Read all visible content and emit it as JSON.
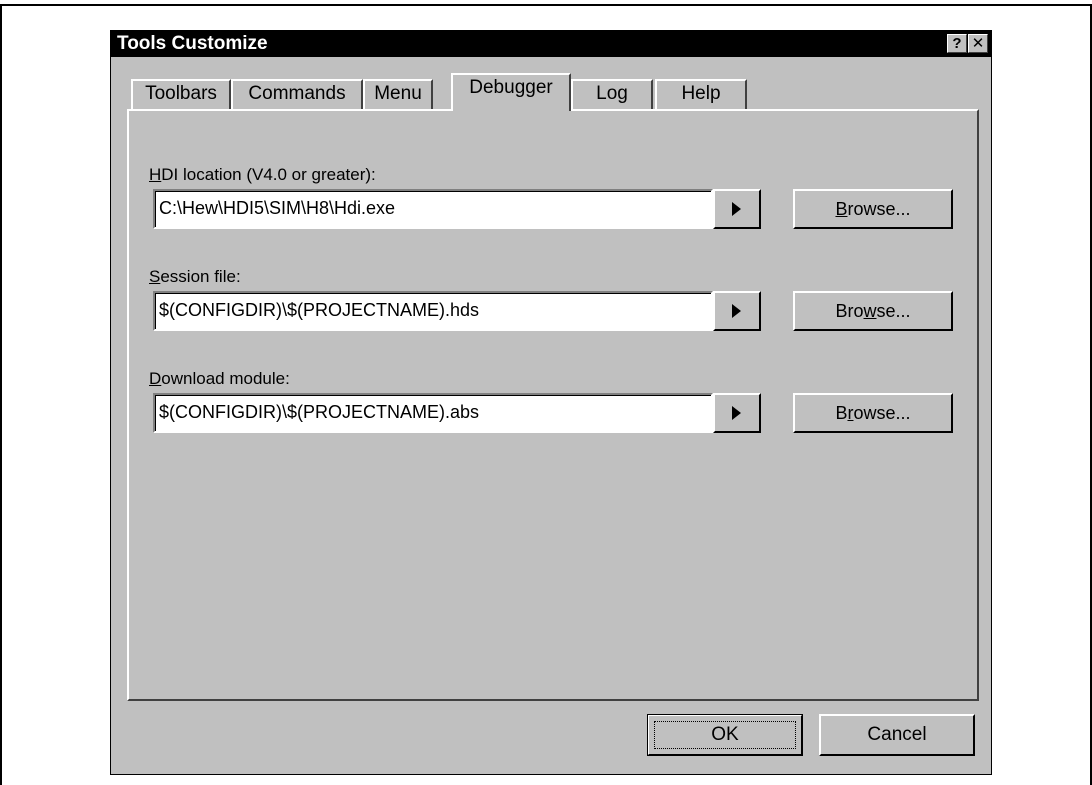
{
  "dialog": {
    "title": "Tools Customize",
    "help_glyph": "?",
    "close_glyph": "✕"
  },
  "tabs": [
    {
      "label": "Toolbars",
      "active": false
    },
    {
      "label": "Commands",
      "active": false
    },
    {
      "label": "Menu",
      "active": false
    },
    {
      "label": "Debugger",
      "active": true
    },
    {
      "label": "Log",
      "active": false
    },
    {
      "label": "Help",
      "active": false
    }
  ],
  "fields": {
    "hdi": {
      "label_mnemonic": "H",
      "label_rest": "DI location (V4.0 or greater):",
      "value": "C:\\Hew\\HDI5\\SIM\\H8\\Hdi.exe",
      "browse_pre": "",
      "browse_mnemonic": "B",
      "browse_post": "rowse..."
    },
    "session": {
      "label_mnemonic": "S",
      "label_rest": "ession file:",
      "value": "$(CONFIGDIR)\\$(PROJECTNAME).hds",
      "browse_pre": "Bro",
      "browse_mnemonic": "w",
      "browse_post": "se..."
    },
    "download": {
      "label_mnemonic": "D",
      "label_rest": "ownload module:",
      "value": "$(CONFIGDIR)\\$(PROJECTNAME).abs",
      "browse_pre": "B",
      "browse_mnemonic": "r",
      "browse_post": "owse..."
    }
  },
  "buttons": {
    "ok": "OK",
    "cancel": "Cancel"
  },
  "icons": {
    "arrow": "right-triangle-icon"
  }
}
